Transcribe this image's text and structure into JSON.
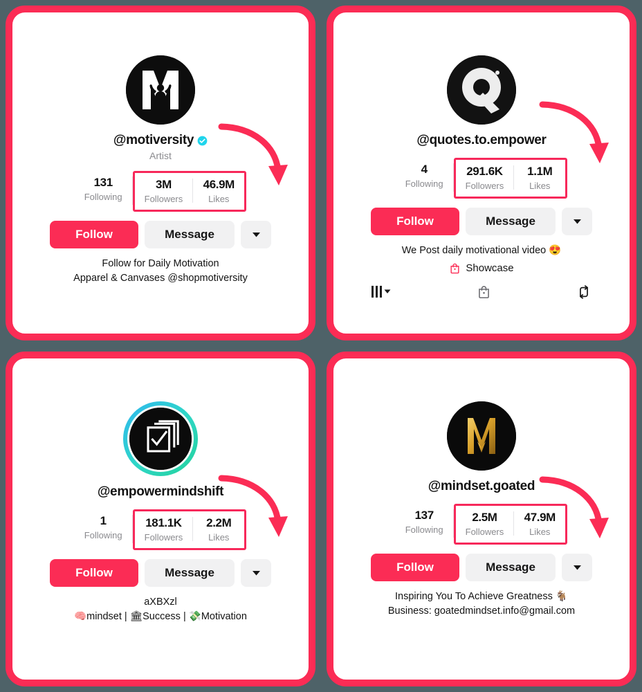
{
  "background_color": "#4e6268",
  "accent_color": "#fb2c55",
  "highlight_color": "#f7285a",
  "labels": {
    "following": "Following",
    "followers": "Followers",
    "likes": "Likes",
    "follow_button": "Follow",
    "message_button": "Message",
    "more_button": "▼"
  },
  "profiles": [
    {
      "username": "@motiversity",
      "verified": true,
      "subtitle": "Artist",
      "avatar": {
        "kind": "motiversity-m-logo",
        "ring": false,
        "bg": "#0d0d0d",
        "fg": "#ffffff"
      },
      "stats": {
        "following": "131",
        "followers": "3M",
        "likes": "46.9M"
      },
      "bio_lines": [
        "Follow for Daily Motivation",
        "Apparel & Canvases @shopmotiversity"
      ],
      "showcase": null,
      "tabs": null
    },
    {
      "username": "@quotes.to.empower",
      "verified": false,
      "subtitle": null,
      "avatar": {
        "kind": "quotes-q-logo",
        "ring": false,
        "bg": "#121212",
        "fg": "#ededed"
      },
      "stats": {
        "following": "4",
        "followers": "291.6K",
        "likes": "1.1M"
      },
      "bio_lines": [
        "We Post daily motivational video 😍"
      ],
      "showcase": {
        "icon": "shopping-bag-icon",
        "label": "Showcase"
      },
      "tabs": [
        {
          "icon": "posts-grid-icon",
          "chevron": true
        },
        {
          "icon": "shopping-bag-icon",
          "chevron": false
        },
        {
          "icon": "repost-icon",
          "chevron": false
        }
      ]
    },
    {
      "username": "@empowermindshift",
      "verified": false,
      "subtitle": null,
      "avatar": {
        "kind": "empower-checkbox-logo",
        "ring": true,
        "bg": "#0b0b0b",
        "fg": "#ffffff"
      },
      "stats": {
        "following": "1",
        "followers": "181.1K",
        "likes": "2.2M"
      },
      "bio_lines": [
        "aXBXzl",
        "🧠mindset | 🏛Success | 💸Motivation"
      ],
      "showcase": null,
      "tabs": null
    },
    {
      "username": "@mindset.goated",
      "verified": false,
      "subtitle": null,
      "avatar": {
        "kind": "goated-m-logo",
        "ring": false,
        "bg": "#0a0a0a",
        "fg": "#e0a62e"
      },
      "stats": {
        "following": "137",
        "followers": "2.5M",
        "likes": "47.9M"
      },
      "bio_lines": [
        "Inspiring You To Achieve Greatness 🐐",
        "Business: goatedmindset.info@gmail.com"
      ],
      "showcase": null,
      "tabs": null
    }
  ]
}
